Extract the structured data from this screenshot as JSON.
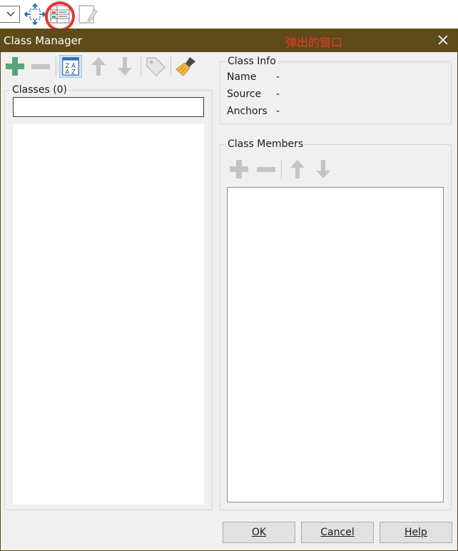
{
  "dialog": {
    "title": "Class Manager",
    "annotation": "弹出的窗口"
  },
  "classes": {
    "legend": "Classes (0)",
    "filter_value": ""
  },
  "class_info": {
    "legend": "Class Info",
    "rows": [
      {
        "label": "Name",
        "value": "-"
      },
      {
        "label": "Source",
        "value": "-"
      },
      {
        "label": "Anchors",
        "value": "-"
      }
    ]
  },
  "class_members": {
    "legend": "Class Members"
  },
  "buttons": {
    "ok": "OK",
    "cancel": "Cancel",
    "help": "Help"
  },
  "colors": {
    "titlebar": "#5f4a1a",
    "annotation": "#e83c2a",
    "highlight_ring": "#e8332f",
    "add_green": "#5aa27a"
  }
}
